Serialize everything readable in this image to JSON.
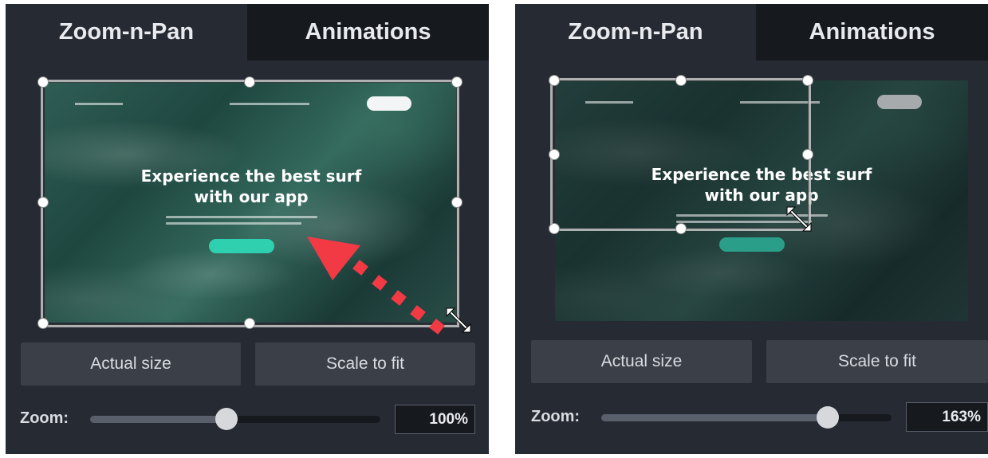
{
  "colors": {
    "panel_bg": "#262a33",
    "inactive_tab_bg": "#16191e",
    "button_bg": "#3a3f48",
    "cta_teal": "#2fd0b0",
    "arrow_red": "#f23a45"
  },
  "left_panel": {
    "tabs": [
      {
        "label": "Zoom-n-Pan",
        "active": true
      },
      {
        "label": "Animations",
        "active": false
      }
    ],
    "preview": {
      "headline_line1": "Experience the best surf",
      "headline_line2": "with our app"
    },
    "buttons": {
      "actual_size": "Actual size",
      "scale_to_fit": "Scale to fit"
    },
    "zoom": {
      "label": "Zoom:",
      "value": "100%",
      "slider_fraction": 0.47
    },
    "annotation_arrow_icon": "red-dashed-arrow-icon",
    "resize_cursor_icon": "diagonal-resize-icon"
  },
  "right_panel": {
    "tabs": [
      {
        "label": "Zoom-n-Pan",
        "active": true
      },
      {
        "label": "Animations",
        "active": false
      }
    ],
    "preview": {
      "headline_line1": "Experience the best surf",
      "headline_line2": "with our app"
    },
    "buttons": {
      "actual_size": "Actual size",
      "scale_to_fit": "Scale to fit"
    },
    "zoom": {
      "label": "Zoom:",
      "value": "163%",
      "slider_fraction": 0.78
    },
    "resize_cursor_icon": "diagonal-resize-icon"
  }
}
